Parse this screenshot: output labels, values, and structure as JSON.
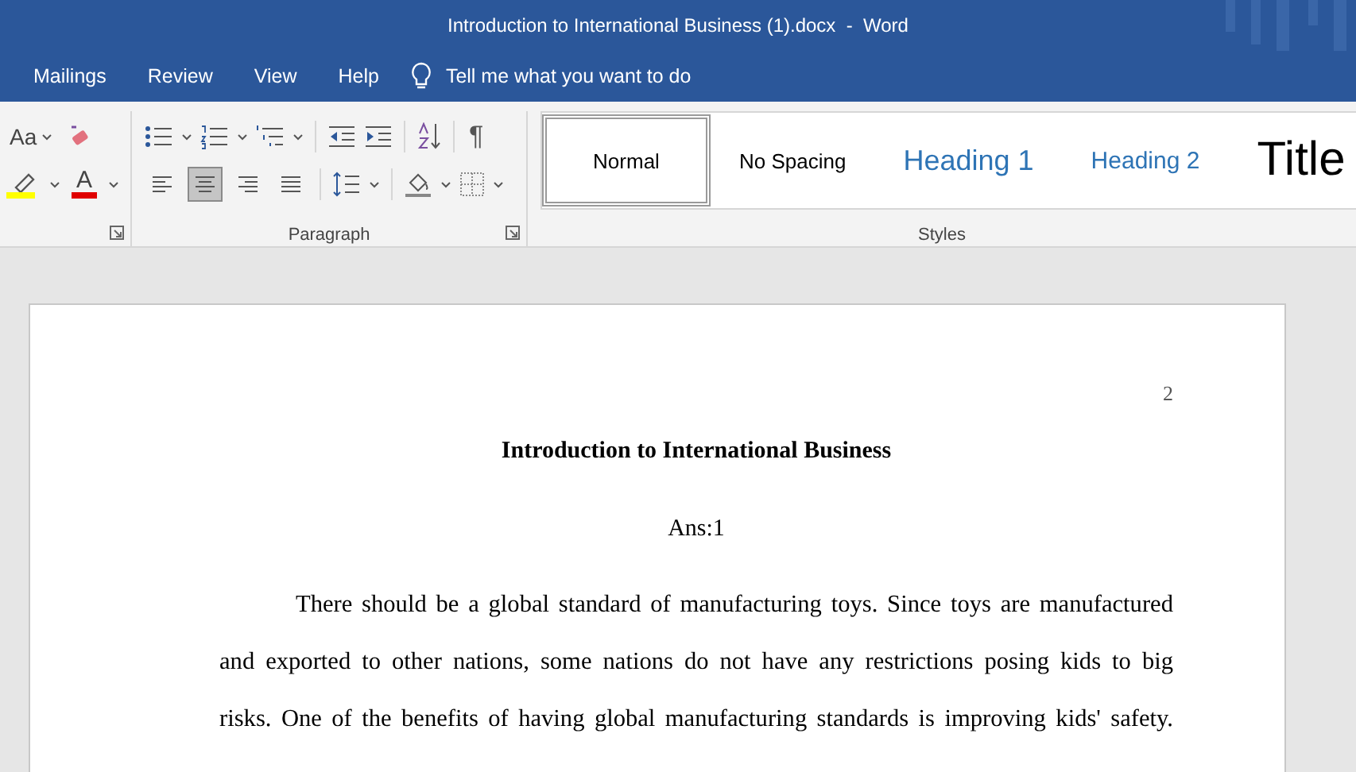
{
  "window": {
    "title": "Introduction to International Business (1).docx  -  Word"
  },
  "menu_tabs": [
    "Mailings",
    "Review",
    "View",
    "Help"
  ],
  "tell_me": {
    "placeholder": "Tell me what you want to do"
  },
  "ribbon": {
    "font_group": {
      "change_case": "Aa",
      "font_color": "A"
    },
    "paragraph_group": {
      "label": "Paragraph",
      "show_marks": "¶",
      "alignment": [
        {
          "kind": "left",
          "selected": false
        },
        {
          "kind": "center",
          "selected": true
        },
        {
          "kind": "right",
          "selected": false
        },
        {
          "kind": "justify",
          "selected": false
        }
      ]
    },
    "styles_group": {
      "label": "Styles",
      "styles": [
        {
          "label": "Normal",
          "kind": "normal",
          "selected": true
        },
        {
          "label": "No Spacing",
          "kind": "no-spacing",
          "selected": false
        },
        {
          "label": "Heading 1",
          "kind": "heading1",
          "selected": false
        },
        {
          "label": "Heading 2",
          "kind": "heading2",
          "selected": false
        },
        {
          "label": "Title",
          "kind": "title",
          "selected": false
        }
      ]
    }
  },
  "document": {
    "page_number": "2",
    "title": "Introduction to International Business",
    "subtitle": "Ans:1",
    "paragraph_lines": [
      "There should be a global standard of manufacturing toys. Since toys are manufactured",
      "and exported to other nations, some nations do not have any restrictions posing kids to big",
      "risks. One of the benefits of having global manufacturing standards is improving kids' safety."
    ]
  }
}
